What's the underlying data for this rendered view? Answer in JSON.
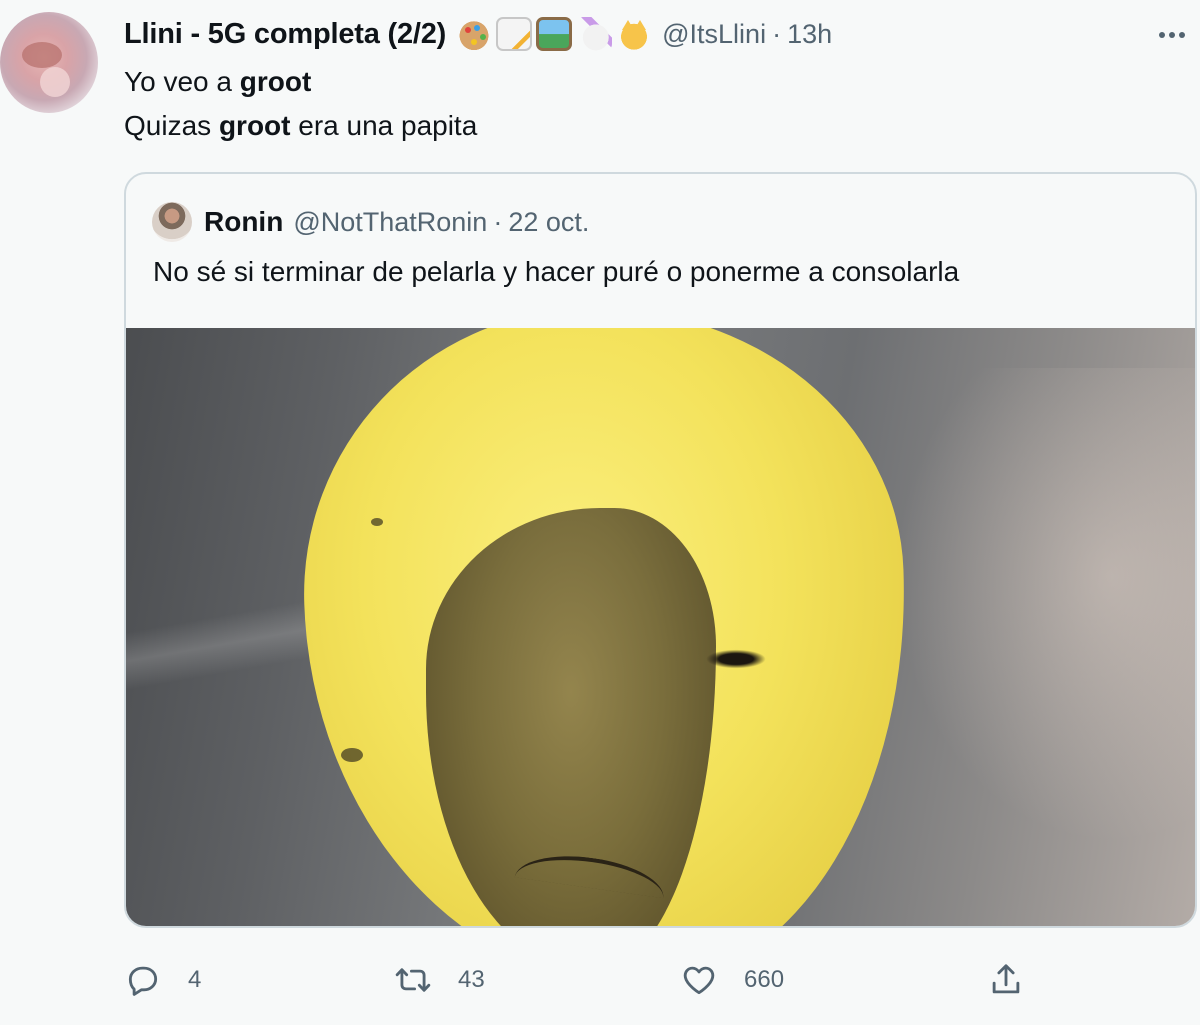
{
  "tweet": {
    "display_name": "Llini - 5G completa (2/2)",
    "name_emojis": [
      "palette-emoji",
      "memo-emoji",
      "picture-emoji",
      "unicorn-emoji",
      "cat-emoji"
    ],
    "handle": "@ItsLlini",
    "separator": "·",
    "time": "13h",
    "line1_before": "Yo veo a ",
    "line1_bold": "groot",
    "line2_before": "Quizas ",
    "line2_bold": "groot",
    "line2_after": " era una papita"
  },
  "quoted": {
    "display_name": "Ronin",
    "handle": "@NotThatRonin",
    "separator": "·",
    "date": "22 oct.",
    "text": "No sé si terminar de pelarla y hacer puré o ponerme a consolarla",
    "media_icon": "potato-face-photo"
  },
  "actions": {
    "reply_count": "4",
    "retweet_count": "43",
    "like_count": "660",
    "share_icon": "share-icon"
  },
  "colors": {
    "text_primary": "#0f1419",
    "text_secondary": "#536471",
    "border": "#cfd9de",
    "background": "#f7f9f9"
  }
}
